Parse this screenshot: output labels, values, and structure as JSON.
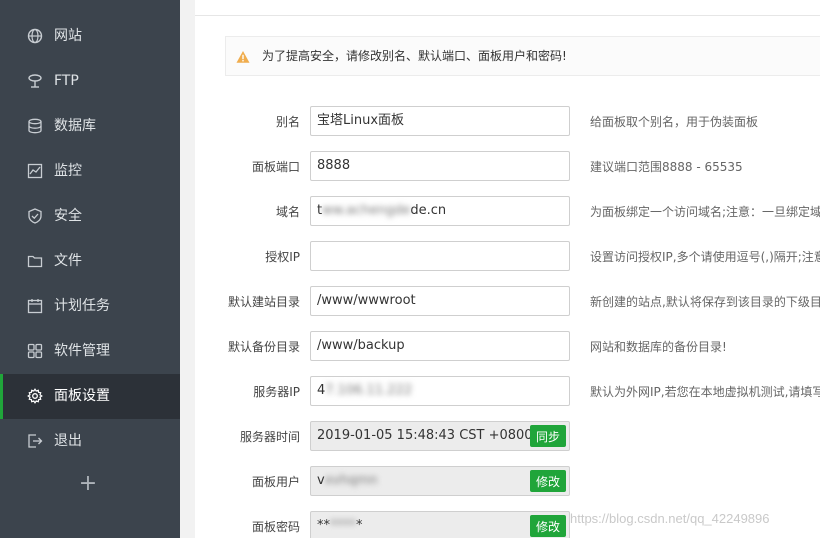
{
  "sidebar": {
    "items": [
      {
        "label": "网站",
        "icon": "globe-icon"
      },
      {
        "label": "FTP",
        "icon": "ftp-icon"
      },
      {
        "label": "数据库",
        "icon": "database-icon"
      },
      {
        "label": "监控",
        "icon": "monitor-icon"
      },
      {
        "label": "安全",
        "icon": "shield-icon"
      },
      {
        "label": "文件",
        "icon": "folder-icon"
      },
      {
        "label": "计划任务",
        "icon": "calendar-icon"
      },
      {
        "label": "软件管理",
        "icon": "grid-icon"
      },
      {
        "label": "面板设置",
        "icon": "gear-icon",
        "active": true
      },
      {
        "label": "退出",
        "icon": "logout-icon"
      }
    ],
    "add_label": "+"
  },
  "alert": {
    "text": "为了提高安全，请修改别名、默认端口、面板用户和密码!",
    "icon": "warning-icon",
    "color": "#f0ad4e"
  },
  "form": {
    "alias": {
      "label": "别名",
      "value": "宝塔Linux面板",
      "hint": "给面板取个别名，用于伪装面板"
    },
    "port": {
      "label": "面板端口",
      "value": "8888",
      "hint": "建议端口范围8888 - 65535"
    },
    "domain": {
      "label": "域名",
      "value_prefix": "t",
      "value_blur": "ww.achengde",
      "value_suffix": "de.cn",
      "hint": "为面板绑定一个访问域名;注意：一旦绑定域"
    },
    "auth_ip": {
      "label": "授权IP",
      "value": "",
      "hint": "设置访问授权IP,多个请使用逗号(,)隔开;注意"
    },
    "site_dir": {
      "label": "默认建站目录",
      "value": "/www/wwwroot",
      "hint": "新创建的站点,默认将保存到该目录的下级目"
    },
    "backup_dir": {
      "label": "默认备份目录",
      "value": "/www/backup",
      "hint": "网站和数据库的备份目录!"
    },
    "server_ip": {
      "label": "服务器IP",
      "value_prefix": "4",
      "value_blur": "7.106.11.222",
      "hint": "默认为外网IP,若您在本地虚拟机测试,请填写"
    },
    "server_time": {
      "label": "服务器时间",
      "value": "2019-01-05 15:48:43 CST +0800",
      "button": "同步"
    },
    "panel_user": {
      "label": "面板用户",
      "value_prefix": "v",
      "value_blur": "xvhqmn",
      "button": "修改"
    },
    "panel_password": {
      "label": "面板密码",
      "value": "**",
      "value_blur": "****",
      "value_suffix": "*",
      "button": "修改"
    }
  },
  "watermark": "https://blog.csdn.net/qq_42249896",
  "colors": {
    "accent": "#20a53a",
    "sidebar": "#3c444d",
    "sidebar_active": "#2c3138"
  }
}
